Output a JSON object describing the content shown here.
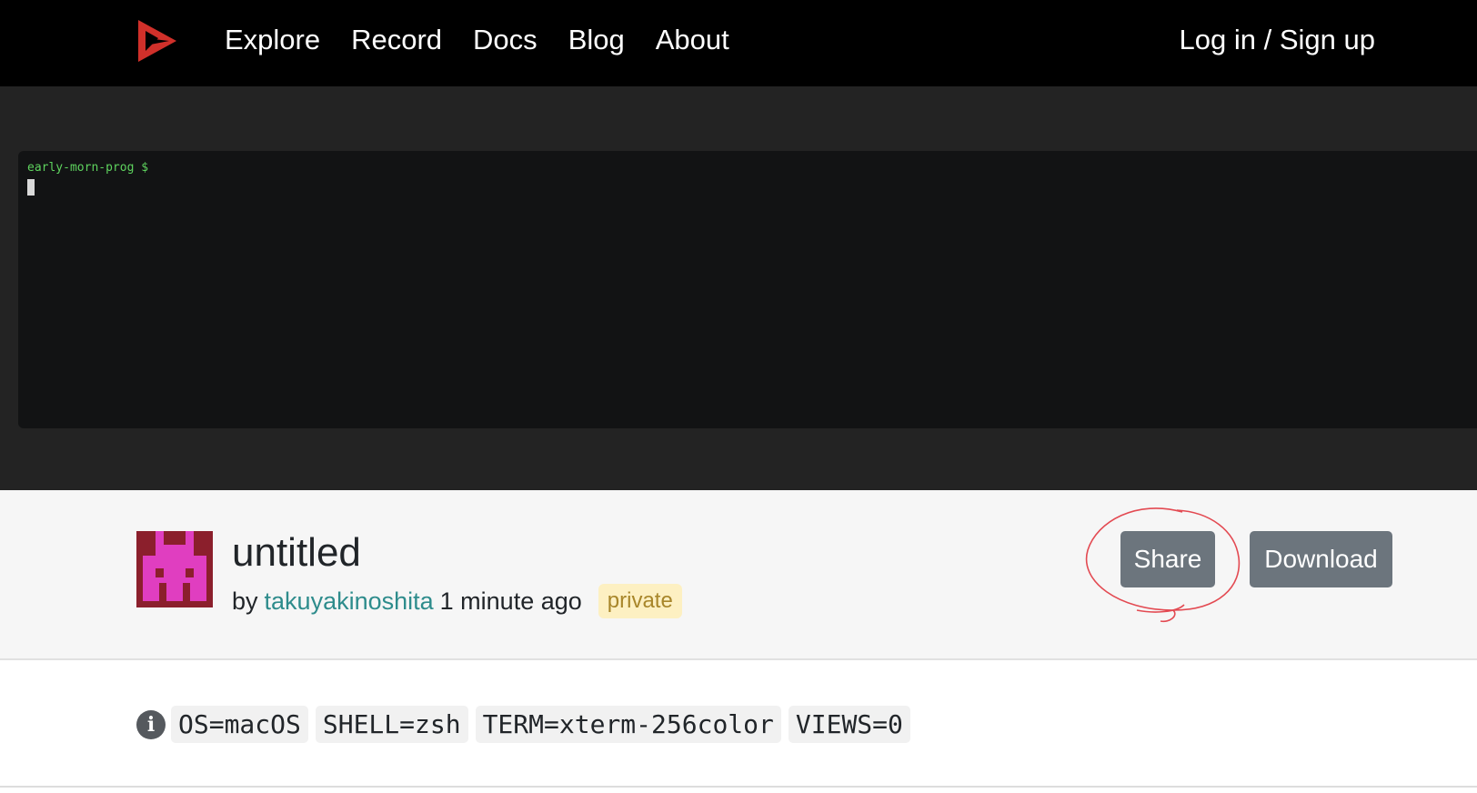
{
  "nav": {
    "logo_icon": "asciinema-play-logo-icon",
    "links": [
      "Explore",
      "Record",
      "Docs",
      "Blog",
      "About"
    ],
    "login": "Log in / Sign up"
  },
  "terminal": {
    "prompt": "early-morn-prog $"
  },
  "recording": {
    "title": "untitled",
    "by": "by",
    "author": "takuyakinoshita",
    "time": "1 minute ago",
    "visibility": "private",
    "share_label": "Share",
    "download_label": "Download"
  },
  "env": {
    "info_icon": "info-icon",
    "tags": [
      "OS=macOS",
      "SHELL=zsh",
      "TERM=xterm-256color",
      "VIEWS=0"
    ]
  },
  "colors": {
    "nav_bg": "#000000",
    "logo_red": "#d0302a",
    "player_bg": "#232323",
    "terminal_bg": "#121314",
    "prompt_green": "#5ed35e",
    "author_link": "#2e8c8c",
    "button_gray": "#6c757d",
    "badge_bg": "#fdf0c2",
    "annotation_red": "#e34a52",
    "avatar_bg": "#8b1f2c",
    "avatar_fg": "#e03ec0"
  }
}
